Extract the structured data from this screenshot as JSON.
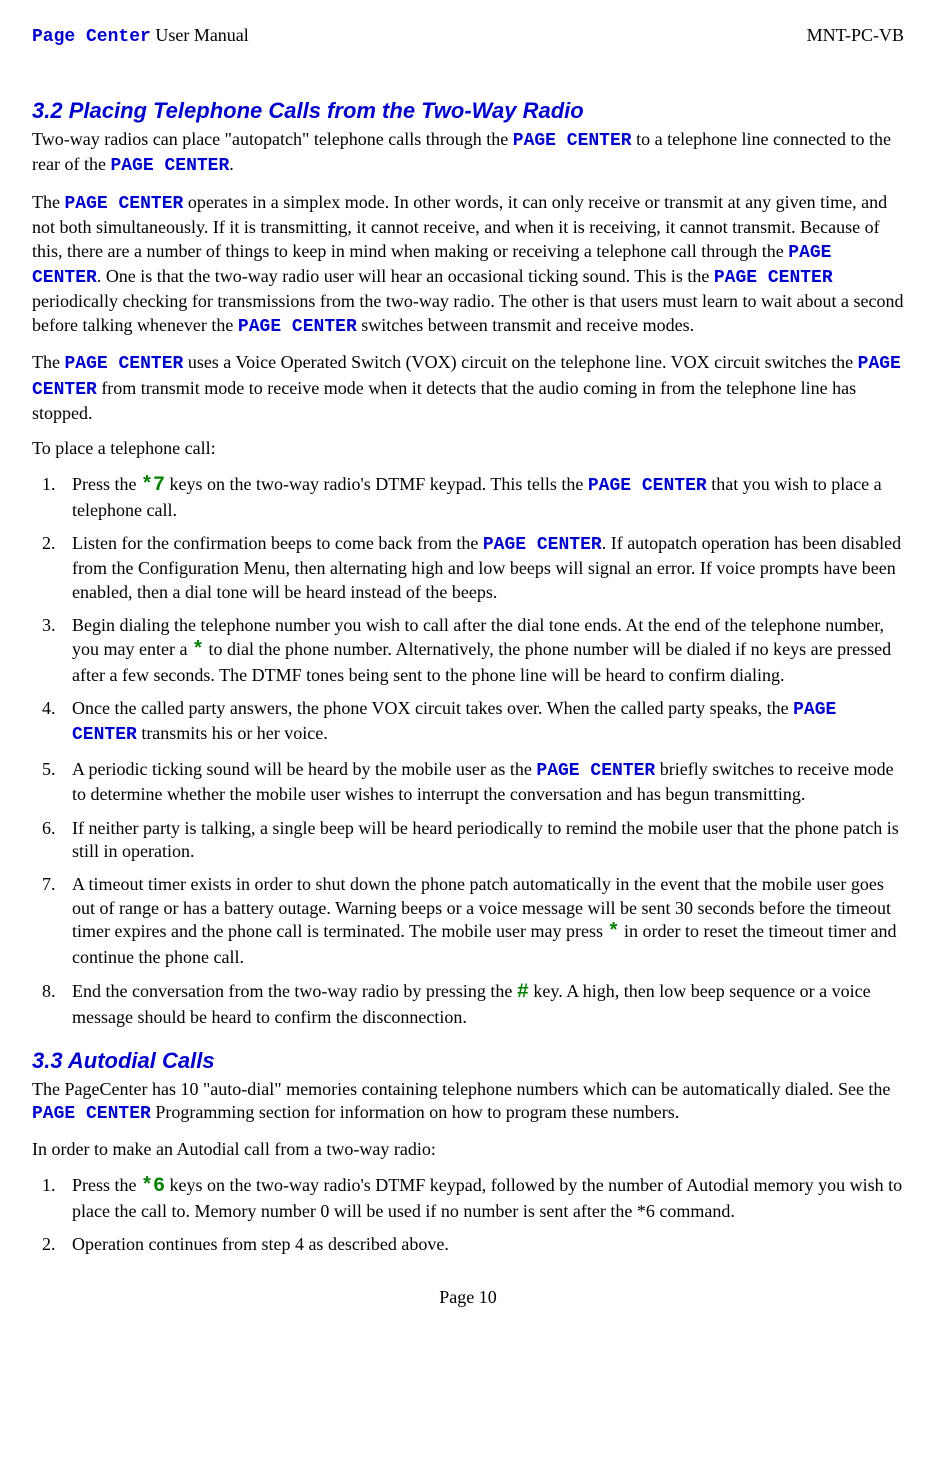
{
  "header": {
    "brand": "Page Center",
    "title_suffix": " User Manual",
    "doc_id": "MNT-PC-VB"
  },
  "s32": {
    "heading": "3.2   Placing Telephone Calls from the Two-Way Radio",
    "p1_a": "Two-way radios can place \"autopatch\" telephone calls through the ",
    "pc": "PAGE CENTER",
    "p1_b": " to a telephone line connected to the rear of the ",
    "p1_c": ".",
    "p2_a": "The ",
    "p2_b": " operates in a simplex mode.  In other words, it can only receive or transmit at any given time, and not both simultaneously.  If it is transmitting, it cannot receive, and when it is receiving, it cannot transmit.  Because of this, there are a number of things to keep in mind when making or receiving a telephone call through the ",
    "p2_c": ".   One is that the two-way radio user will hear an occasional ticking sound.  This is the ",
    "p2_d": " periodically checking for transmissions from the two-way radio.  The other is that users must learn to wait about a second before talking whenever the ",
    "p2_e": " switches between transmit and receive modes.",
    "p3_a": "The ",
    "p3_b": " uses a Voice Operated Switch (VOX) circuit on the telephone line.  VOX circuit switches the ",
    "p3_c": " from transmit mode to receive mode when it detects that the audio coming in from the telephone line has stopped.",
    "p4": "To place a telephone call:",
    "li1_a": "Press the ",
    "li1_key": "*7",
    "li1_b": " keys on the two-way radio's DTMF keypad.  This tells the ",
    "li1_c": " that you wish to place a telephone call.",
    "li2_a": "Listen for the confirmation beeps to come back from the ",
    "li2_b": ".   If autopatch operation has been disabled from the Configuration Menu, then alternating high and low beeps will signal an error. If voice prompts have been enabled, then a dial tone will be heard instead of the beeps.",
    "li3_a": "Begin dialing the telephone number you wish to call after the dial tone ends.  At the end of the telephone number, you may enter a ",
    "li3_key": "*",
    "li3_b": " to dial the phone number.  Alternatively, the phone number will be dialed if no keys are pressed after a few seconds.  The DTMF tones being sent to the phone line will be heard to confirm dialing.",
    "li4_a": "Once the called party answers, the phone VOX circuit takes over.  When the called party speaks, the ",
    "li4_b": " transmits his or her voice.",
    "li5_a": "A periodic ticking sound will be heard by the mobile user as the ",
    "li5_b": " briefly switches to receive mode to determine whether the mobile user wishes to interrupt the conversation and has begun transmitting.",
    "li6": "If neither party is talking, a single beep will be heard periodically to remind the mobile user that the phone patch is still in operation.",
    "li7_a": "A timeout timer exists in order to shut down the phone patch automatically in the event that the mobile user goes out of range or has a battery outage.  Warning beeps or a voice message will be sent 30 seconds before the timeout timer expires and the phone call is terminated.  The mobile user may press ",
    "li7_key": "*",
    "li7_b": " in order to reset the timeout timer and continue the phone call.",
    "li8_a": "End the conversation from the two-way radio by pressing the ",
    "li8_key": "#",
    "li8_b": " key.  A high, then low beep sequence or a voice message should be heard to confirm the disconnection."
  },
  "s33": {
    "heading": "3.3   Autodial Calls",
    "p1_a": "The PageCenter has 10 \"auto-dial\" memories containing telephone numbers which can be automatically dialed.  See the ",
    "p1_b": " Programming section for information on how to program these numbers.",
    "p2": "In order to make an Autodial call from a two-way radio:",
    "li1_a": "Press the ",
    "li1_key": "*6",
    "li1_b": "  keys on the two-way radio's DTMF keypad, followed by the number of Autodial memory you wish to place the call to.  Memory number 0 will be used if no number is sent after the *6 command.",
    "li2": "Operation continues from step 4 as described above."
  },
  "footer": "Page 10"
}
